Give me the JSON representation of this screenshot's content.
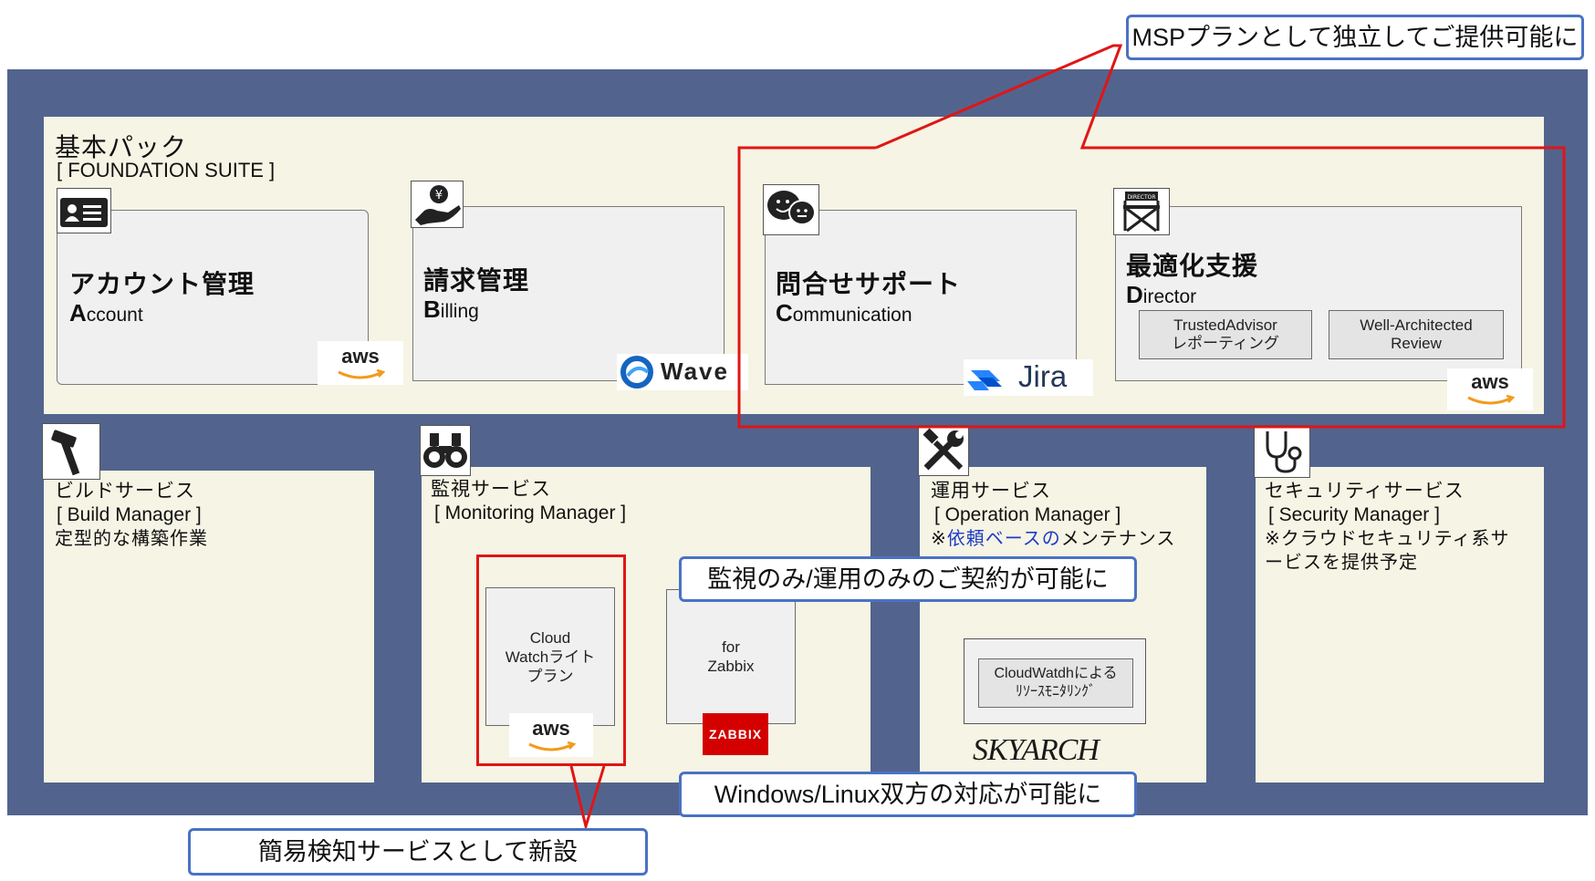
{
  "callouts": {
    "msp": "MSPプランとして独立してご提供可能に",
    "monitor_only": "監視のみ/運用のみのご契約が可能に",
    "windows_linux": "Windows/Linux双方の対応が可能に",
    "simple_detect": "簡易検知サービスとして新設"
  },
  "foundation": {
    "title": "基本パック",
    "subtitle": "[ FOUNDATION SUITE ]",
    "cards": [
      {
        "jp": "アカウント管理",
        "en_initial": "A",
        "en_rest": "ccount",
        "logo": "aws",
        "icon": "id-card-icon"
      },
      {
        "jp": "請求管理",
        "en_initial": "B",
        "en_rest": "illing",
        "logo": "Wave",
        "icon": "hand-coin-icon"
      },
      {
        "jp": "問合せサポート",
        "en_initial": "C",
        "en_rest": "ommunication",
        "logo": "Jira",
        "icon": "chat-faces-icon"
      },
      {
        "jp": "最適化支援",
        "en_initial": "D",
        "en_rest": "irector",
        "logo": "aws",
        "icon": "director-chair-icon",
        "sub_items": [
          {
            "line1": "TrustedAdvisor",
            "line2": "レポーティング"
          },
          {
            "line1": "Well-Architected",
            "line2": "Review"
          }
        ]
      }
    ]
  },
  "services": [
    {
      "title": "ビルドサービス",
      "subtitle": "[ Build Manager ]",
      "note": "定型的な構築作業",
      "icon": "hammer-icon"
    },
    {
      "title": "監視サービス",
      "subtitle": "[ Monitoring Manager ]",
      "icon": "binoculars-icon",
      "items": [
        {
          "lines": [
            "Cloud",
            "Watchライト",
            "プラン"
          ],
          "logo": "aws"
        },
        {
          "lines": [
            "for",
            "Zabbix"
          ],
          "logo": "ZABBIX"
        }
      ]
    },
    {
      "title": "運用サービス",
      "subtitle": "[ Operation Manager ]",
      "note_prefix": "※",
      "note_highlight": "依頼ベースの",
      "note_rest": "メンテナンス",
      "icon": "tools-icon",
      "inner": {
        "line1": "CloudWatdhによる",
        "line2": "ﾘｿｰｽﾓﾆﾀﾘﾝｸﾞ"
      },
      "logo": "SKYARCH"
    },
    {
      "title": "セキュリティサービス",
      "subtitle": "[ Security Manager ]",
      "note_line1": "※クラウドセキュリティ系サ",
      "note_line2": "ービスを提供予定",
      "icon": "stethoscope-icon"
    }
  ],
  "logos": {
    "aws": "aws",
    "wave": "Wave",
    "jira": "Jira",
    "zabbix": "ZABBIX",
    "skyarch": "SKYARCH",
    "director_sign": "DIRECTOR"
  },
  "colors": {
    "frame": "#52648e",
    "panel": "#f6f4e4",
    "card": "#f0f0f0",
    "callout_border": "#4a72c4",
    "highlight_red": "#e01515",
    "zabbix_red": "#d40000",
    "aws_orange": "#f29b1d",
    "jira_blue": "#2684ff",
    "wave_blue": "#1565c0",
    "note_blue": "#1f3cc8"
  }
}
